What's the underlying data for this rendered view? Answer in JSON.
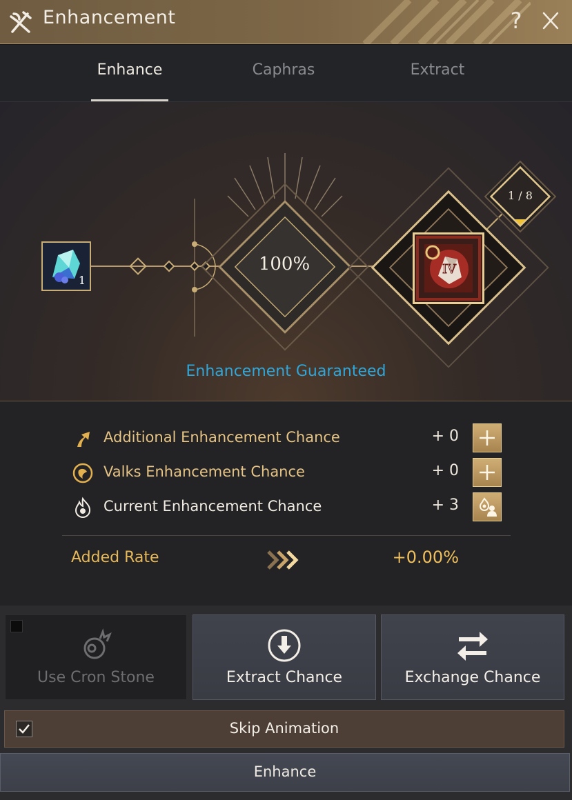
{
  "window": {
    "title": "Enhancement",
    "help_label": "?"
  },
  "tabs": [
    {
      "label": "Enhance",
      "active": true
    },
    {
      "label": "Caphras",
      "active": false
    },
    {
      "label": "Extract",
      "active": false
    }
  ],
  "stage": {
    "material_count": "1",
    "success_rate": "100%",
    "stack_progress": "1 / 8",
    "target_grade": "IV",
    "status_text": "Enhancement Guaranteed"
  },
  "stats": [
    {
      "label": "Additional Enhancement Chance",
      "value": "+ 0",
      "icon": "arrow-up-icon",
      "button": "add-icon"
    },
    {
      "label": "Valks Enhancement Chance",
      "value": "+ 0",
      "icon": "valks-globe-icon",
      "button": "add-icon"
    },
    {
      "label": "Current Enhancement Chance",
      "value": "+ 3",
      "icon": "flame-icon",
      "button": "stack-manage-icon"
    }
  ],
  "added_rate": {
    "label": "Added Rate",
    "value": "+0.00%"
  },
  "actions": {
    "cron_stone": "Use Cron Stone",
    "extract_chance": "Extract Chance",
    "exchange_chance": "Exchange Chance",
    "skip_animation": "Skip Animation",
    "skip_animation_checked": true,
    "enhance": "Enhance"
  },
  "colors": {
    "accent_gold": "#e5c485",
    "status_blue": "#2fa6d9",
    "title_bar": "#7d6747"
  }
}
